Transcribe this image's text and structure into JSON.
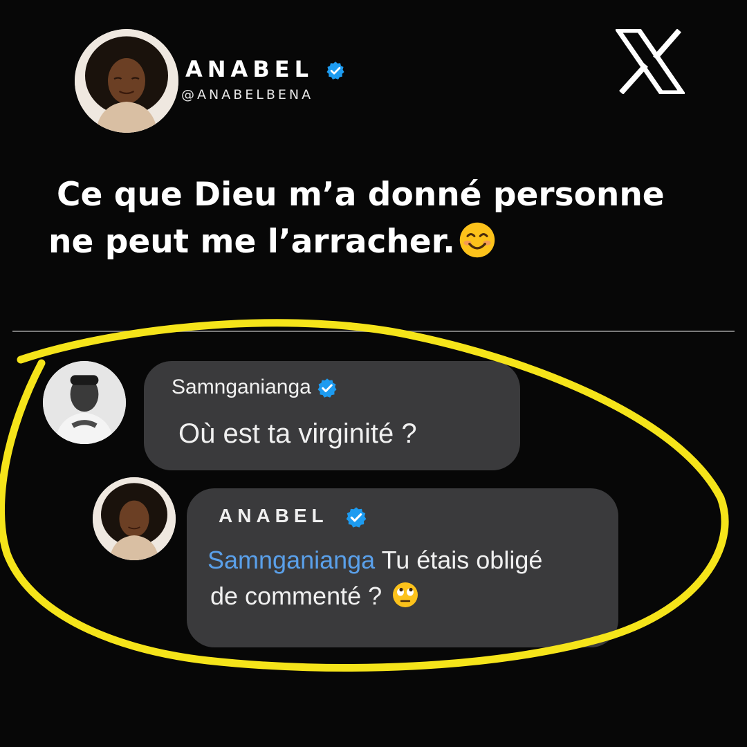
{
  "author": {
    "name": "ANABEL",
    "handle": "@ANABELBENA",
    "verified": true,
    "avatar_icon": "profile-photo-woman"
  },
  "brand": {
    "logo_icon": "x-logo"
  },
  "post": {
    "text_line1": "Ce que Dieu m’a donné personne",
    "text_line2": "ne peut me l’arracher.",
    "emoji": "smiling-face-icon"
  },
  "replies": [
    {
      "username": "Samnganianga",
      "verified": true,
      "avatar_icon": "profile-photo-man",
      "text": "Où est ta virginité ?"
    },
    {
      "username": "ANABEL",
      "verified": true,
      "avatar_icon": "profile-photo-woman",
      "mention": "Samnganianga",
      "text_line1": "Tu étais obligé",
      "text_line2": "de commenté ?",
      "emoji": "eye-roll-face-icon"
    }
  ],
  "annotation": {
    "color": "#f5e41a",
    "shape": "hand-drawn-circle"
  },
  "colors": {
    "background": "#070707",
    "bubble": "#3a3a3c",
    "verified": "#1d9bf0",
    "mention": "#5aa0ea"
  }
}
